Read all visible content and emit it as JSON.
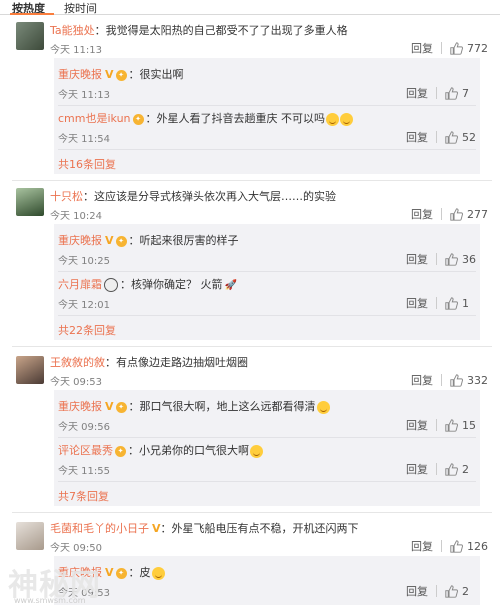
{
  "tabs": {
    "hot": "按热度",
    "time": "按时间"
  },
  "comments": [
    {
      "user": "Ta能独处",
      "text": "：我觉得是太阳热的自己都受不了了出现了多重人格",
      "time": "今天 11:13",
      "reply": "回复",
      "likes": "772",
      "replies": [
        {
          "user": "重庆晚报",
          "text": "：很实出啊",
          "time": "今天 11:13",
          "reply": "回复",
          "likes": "7"
        },
        {
          "user": "cmm也是ikun",
          "text": "：外星人看了抖音去趟重庆 不可以吗",
          "time": "今天 11:54",
          "reply": "回复",
          "likes": "52"
        }
      ],
      "more": "共16条回复"
    },
    {
      "user": "十只松",
      "text": "：这应该是分导式核弹头依次再入大气层……的实验",
      "time": "今天 10:24",
      "reply": "回复",
      "likes": "277",
      "replies": [
        {
          "user": "重庆晚报",
          "text": "：听起来很厉害的样子",
          "time": "今天 10:25",
          "reply": "回复",
          "likes": "36"
        },
        {
          "user": "六月扉霜",
          "text": "：核弹你确定？ 火箭",
          "time": "今天 12:01",
          "reply": "回复",
          "likes": "1"
        }
      ],
      "more": "共22条回复"
    },
    {
      "user": "王敘敘的敘",
      "text": "：有点像边走路边抽烟吐烟圈",
      "time": "今天 09:53",
      "reply": "回复",
      "likes": "332",
      "replies": [
        {
          "user": "重庆晚报",
          "text": "：那口气很大啊，地上这么远都看得清",
          "time": "今天 09:56",
          "reply": "回复",
          "likes": "15"
        },
        {
          "user": "评论区最秀",
          "text": "：小兄弟你的口气很大啊",
          "time": "今天 11:55",
          "reply": "回复",
          "likes": "2"
        }
      ],
      "more": "共7条回复"
    },
    {
      "user": "毛菌和毛丫的小日子",
      "text": "：外星飞船电压有点不稳，开机还闪两下",
      "time": "今天 09:50",
      "reply": "回复",
      "likes": "126",
      "replies": [
        {
          "user": "重庆晚报",
          "text": "：皮",
          "time": "今天 09:53",
          "reply": "回复",
          "likes": "2"
        }
      ]
    }
  ],
  "watermark": "神秘网",
  "watermark_url": "www.smwsm.com",
  "colors": {
    "link": "#eb7350",
    "subBg": "#f2f2f5",
    "tabUnderline": "#fa7d3c"
  }
}
